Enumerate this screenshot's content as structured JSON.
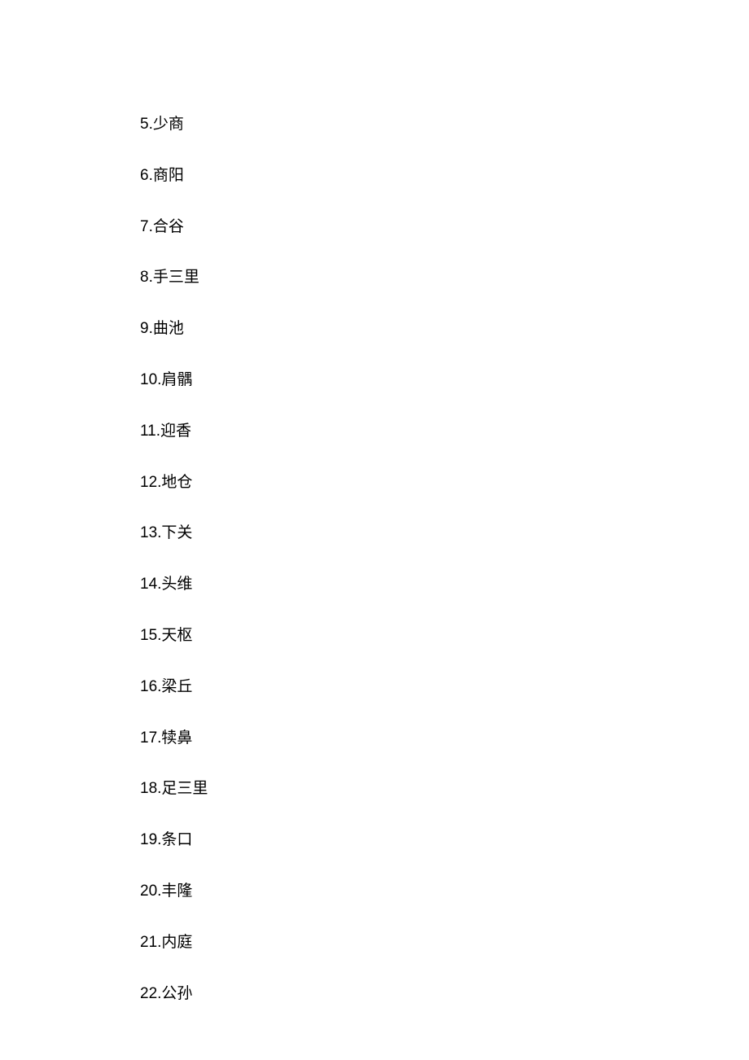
{
  "items": [
    {
      "number": "5",
      "name": "少商"
    },
    {
      "number": "6",
      "name": "商阳"
    },
    {
      "number": "7",
      "name": "合谷"
    },
    {
      "number": "8",
      "name": "手三里"
    },
    {
      "number": "9",
      "name": "曲池"
    },
    {
      "number": "10",
      "name": "肩髃"
    },
    {
      "number": "11",
      "name": "迎香"
    },
    {
      "number": "12",
      "name": "地仓"
    },
    {
      "number": "13",
      "name": "下关"
    },
    {
      "number": "14",
      "name": "头维"
    },
    {
      "number": "15",
      "name": "天枢"
    },
    {
      "number": "16",
      "name": "梁丘"
    },
    {
      "number": "17",
      "name": "犊鼻"
    },
    {
      "number": "18",
      "name": "足三里"
    },
    {
      "number": "19",
      "name": "条口"
    },
    {
      "number": "20",
      "name": "丰隆"
    },
    {
      "number": "21",
      "name": "内庭"
    },
    {
      "number": "22",
      "name": "公孙"
    }
  ]
}
